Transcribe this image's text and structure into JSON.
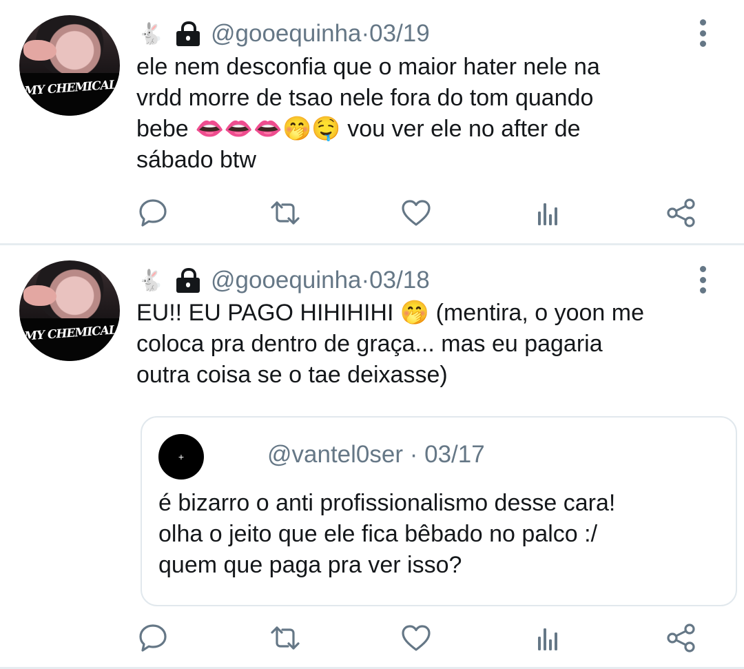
{
  "tweets": [
    {
      "prefix_emoji": "🐇",
      "handle": "@gooequinha",
      "separator": " · ",
      "date": "03/19",
      "avatar_shirt_text": "MY CHEMICAL",
      "text": "ele nem desconfia que o maior hater nele na\nvrdd morre de tsao nele fora do tom quando\nbebe 👄👄👄🤭🤤 vou ver ele no after de\nsábado btw"
    },
    {
      "prefix_emoji": "🐇",
      "handle": "@gooequinha",
      "separator": " · ",
      "date": "03/18",
      "avatar_shirt_text": "MY CHEMICAL",
      "text": "EU!! EU PAGO HIHIHIHI 🤭 (mentira, o yoon me\ncoloca pra dentro de graça... mas eu pagaria\noutra coisa se o tae deixasse)",
      "quote": {
        "avatar_glyph": "+",
        "handle": "@vantel0ser",
        "separator": " · ",
        "date": "03/17",
        "text": "é bizarro o anti profissionalismo desse cara!\nolha o jeito que ele fica bêbado no palco :/\nquem que paga pra ver isso?"
      }
    }
  ],
  "icons": {
    "reply": "reply-icon",
    "retweet": "retweet-icon",
    "like": "heart-icon",
    "analytics": "analytics-icon",
    "share": "share-icon",
    "more": "more-vertical-icon",
    "lock": "lock-icon"
  },
  "colors": {
    "text": "#14171a",
    "secondary": "#657786",
    "divider": "#e6ecf0"
  }
}
